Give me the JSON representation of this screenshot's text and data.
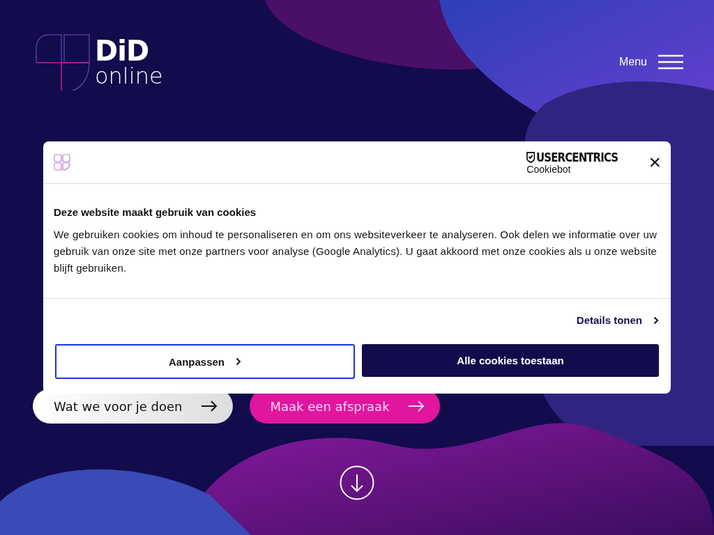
{
  "header": {
    "logo_top": "DiD",
    "logo_bottom": "online",
    "menu_label": "Menu"
  },
  "hero": {
    "buttons": [
      {
        "label": "Wat we voor je doen",
        "kind": "light"
      },
      {
        "label": "Maak een afspraak",
        "kind": "pink"
      }
    ]
  },
  "cookie_dialog": {
    "brand_top": "USERCENTRICS",
    "brand_bottom": "Cookiebot",
    "close": "×",
    "title": "Deze website maakt gebruik van cookies",
    "body": "We gebruiken cookies om inhoud te personaliseren en om ons websiteverkeer te analyseren. Ook delen we informatie over uw gebruik van onze site met onze partners voor analyse (Google Analytics). U gaat akkoord met onze cookies als u onze website blijft gebruiken.",
    "details_link": "Details tonen",
    "buttons": [
      {
        "label": "Aanpassen",
        "kind": "outline"
      },
      {
        "label": "Alle cookies toestaan",
        "kind": "solid"
      }
    ]
  }
}
